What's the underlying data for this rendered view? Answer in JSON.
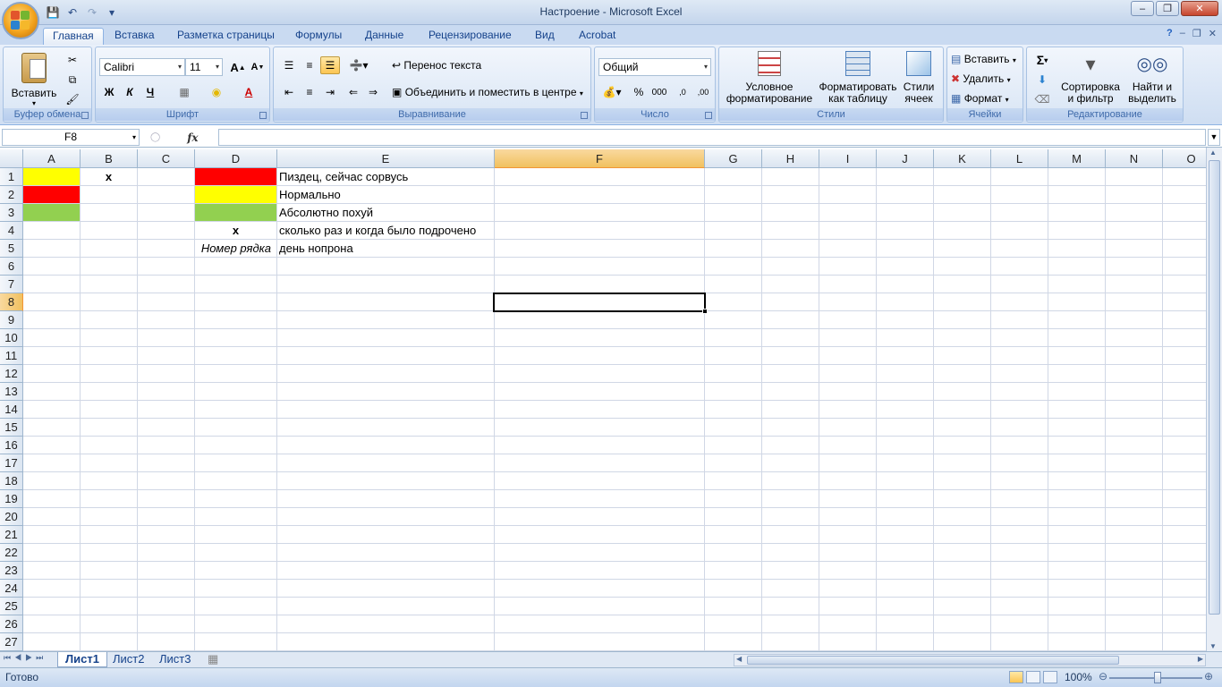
{
  "window": {
    "title": "Настроение - Microsoft Excel"
  },
  "qat": {
    "save": "save-icon",
    "undo": "undo-icon",
    "redo": "redo-icon",
    "customize": "▾"
  },
  "tabs": [
    "Главная",
    "Вставка",
    "Разметка страницы",
    "Формулы",
    "Данные",
    "Рецензирование",
    "Вид",
    "Acrobat"
  ],
  "active_tab": "Главная",
  "ribbon": {
    "clipboard": {
      "label": "Буфер обмена",
      "paste": "Вставить"
    },
    "font": {
      "label": "Шрифт",
      "name": "Calibri",
      "size": "11",
      "bold": "Ж",
      "italic": "К",
      "underline": "Ч",
      "grow": "A",
      "shrink": "A"
    },
    "alignment": {
      "label": "Выравнивание",
      "wrap": "Перенос текста",
      "merge": "Объединить и поместить в центре"
    },
    "number": {
      "label": "Число",
      "format": "Общий",
      "percent": "%",
      "thousands": "000",
      "inc": ",0",
      "dec": ",00"
    },
    "styles": {
      "label": "Стили",
      "conditional": "Условное форматирование",
      "as_table": "Форматировать как таблицу",
      "cell_styles": "Стили ячеек"
    },
    "cells": {
      "label": "Ячейки",
      "insert": "Вставить",
      "delete": "Удалить",
      "format": "Формат"
    },
    "editing": {
      "label": "Редактирование",
      "sum": "Σ",
      "sort": "Сортировка и фильтр",
      "find": "Найти и выделить"
    }
  },
  "formula_bar": {
    "name_box": "F8",
    "fx": "fx",
    "value": ""
  },
  "columns": [
    "A",
    "B",
    "C",
    "D",
    "E",
    "F",
    "G",
    "H",
    "I",
    "J",
    "K",
    "L",
    "M",
    "N",
    "O"
  ],
  "selected_column": "F",
  "rows": [
    "1",
    "2",
    "3",
    "4",
    "5",
    "6",
    "7",
    "8",
    "9",
    "10",
    "11",
    "12",
    "13",
    "14",
    "15",
    "16",
    "17",
    "18",
    "19",
    "20",
    "21",
    "22",
    "23",
    "24",
    "25",
    "26",
    "27"
  ],
  "selected_row": "8",
  "cells": {
    "B1": "x",
    "D4": "x",
    "D5": "Номер рядка",
    "E1": "Пиздец, сейчас сорвусь",
    "E2": "Нормально",
    "E3": "Абсолютно похуй",
    "E4": "сколько раз и когда было подрочено",
    "E5": "день нопрона"
  },
  "fills": {
    "red": "#ff0000",
    "yellow": "#ffff00",
    "green": "#92d050"
  },
  "sheets": [
    "Лист1",
    "Лист2",
    "Лист3"
  ],
  "active_sheet": "Лист1",
  "status": {
    "text": "Готово",
    "zoom": "100%"
  }
}
